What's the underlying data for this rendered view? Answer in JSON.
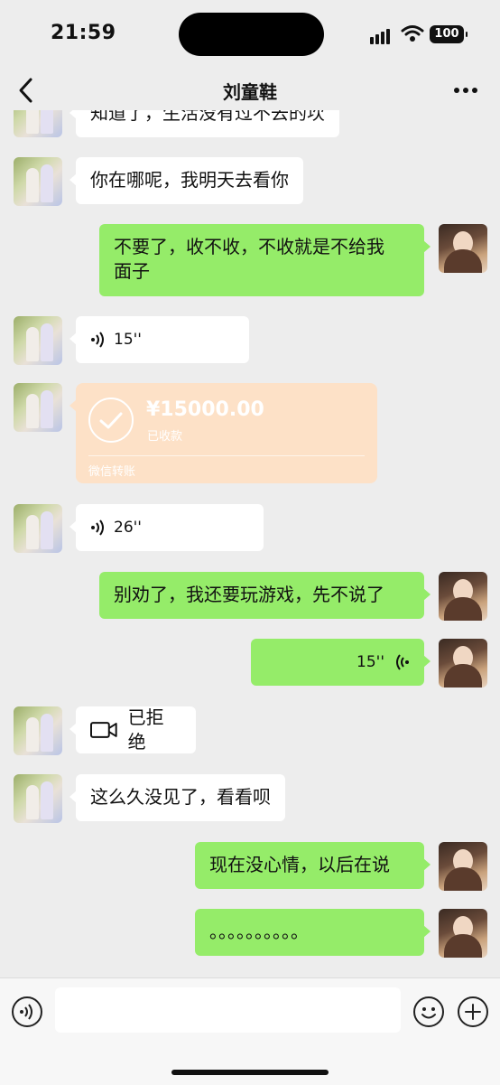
{
  "status_bar": {
    "time": "21:59",
    "battery": "100"
  },
  "header": {
    "title": "刘童鞋"
  },
  "messages": [
    {
      "side": "left",
      "type": "text",
      "text": "知道了，生活没有过不去的坎"
    },
    {
      "side": "left",
      "type": "text",
      "text": "你在哪呢，我明天去看你"
    },
    {
      "side": "right",
      "type": "text",
      "line1": "不要了，收不收，不收就是不给我",
      "line2": "面子"
    },
    {
      "side": "left",
      "type": "voice",
      "duration": "15''"
    },
    {
      "side": "left",
      "type": "transfer",
      "amount": "¥15000.00",
      "status": "已收款",
      "source": "微信转账"
    },
    {
      "side": "left",
      "type": "voice",
      "duration": "26''"
    },
    {
      "side": "right",
      "type": "text",
      "text": "别劝了，我还要玩游戏，先不说了"
    },
    {
      "side": "right",
      "type": "voice",
      "duration": "15''"
    },
    {
      "side": "left",
      "type": "video_call",
      "text": "已拒绝"
    },
    {
      "side": "left",
      "type": "text",
      "text": "这么久没见了，看看呗"
    },
    {
      "side": "right",
      "type": "text",
      "text": "现在没心情，以后在说"
    },
    {
      "side": "right",
      "type": "text",
      "text": "。。。。。。。。。。"
    }
  ],
  "colors": {
    "self_bubble": "#95ec69",
    "other_bubble": "#ffffff",
    "transfer_card": "#fde1c7",
    "background": "#ededed"
  },
  "icons": [
    "back-chevron-icon",
    "more-dots-icon",
    "voice-input-icon",
    "emoji-icon",
    "plus-icon",
    "video-call-icon",
    "check-circle-icon"
  ]
}
